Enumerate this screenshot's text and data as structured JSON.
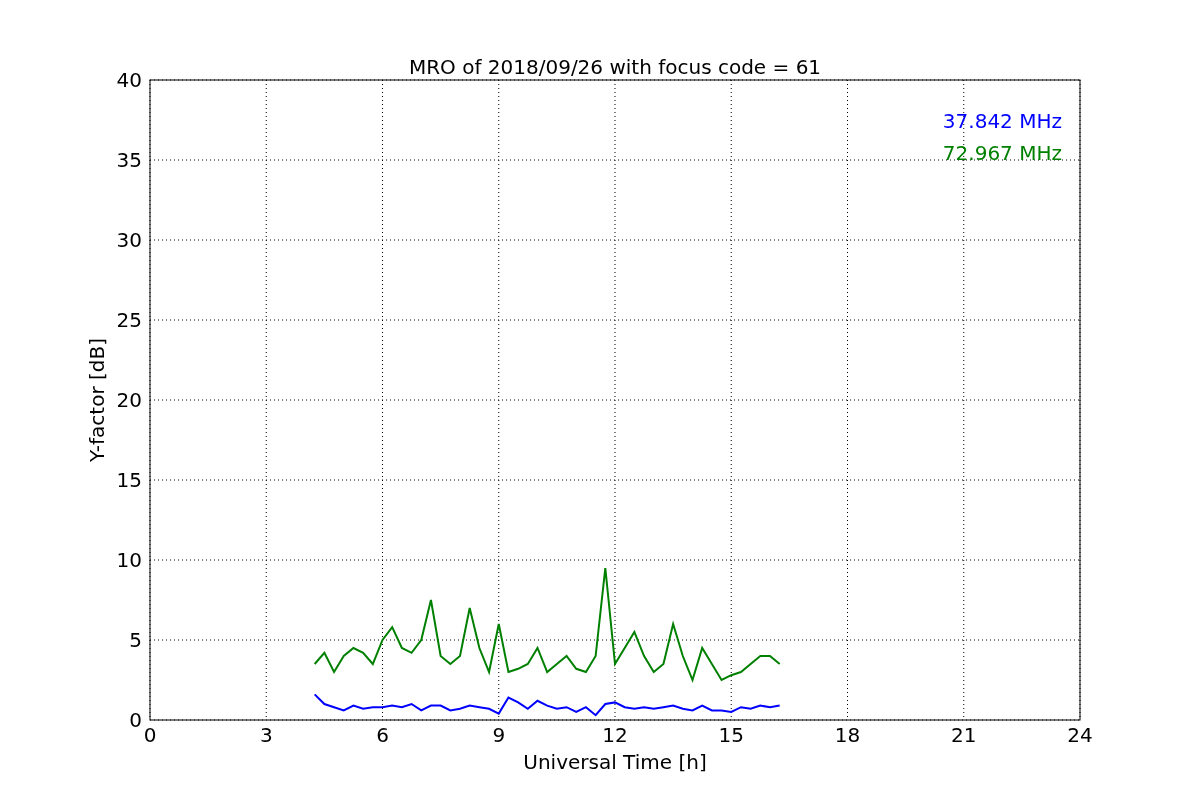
{
  "chart_data": {
    "type": "line",
    "title": "MRO of 2018/09/26 with focus code = 61",
    "xlabel": "Universal Time [h]",
    "ylabel": "Y-factor [dB]",
    "x": [
      4.25,
      4.5,
      4.75,
      5,
      5.25,
      5.5,
      5.75,
      6,
      6.25,
      6.5,
      6.75,
      7,
      7.25,
      7.5,
      7.75,
      8,
      8.25,
      8.5,
      8.75,
      9,
      9.25,
      9.5,
      9.75,
      10,
      10.25,
      10.5,
      10.75,
      11,
      11.25,
      11.5,
      11.75,
      12,
      12.25,
      12.5,
      12.75,
      13,
      13.25,
      13.5,
      13.75,
      14,
      14.25,
      14.5,
      14.75,
      15,
      15.25,
      15.5,
      15.75,
      16,
      16.25
    ],
    "series": [
      {
        "name": "37.842 MHz",
        "color": "#0000ff",
        "values": [
          1.6,
          1.0,
          0.8,
          0.6,
          0.9,
          0.7,
          0.8,
          0.8,
          0.9,
          0.8,
          1.0,
          0.6,
          0.9,
          0.9,
          0.6,
          0.7,
          0.9,
          0.8,
          0.7,
          0.4,
          1.4,
          1.1,
          0.7,
          1.2,
          0.9,
          0.7,
          0.8,
          0.5,
          0.8,
          0.3,
          1.0,
          1.1,
          0.8,
          0.7,
          0.8,
          0.7,
          0.8,
          0.9,
          0.7,
          0.6,
          0.9,
          0.6,
          0.6,
          0.5,
          0.8,
          0.7,
          0.9,
          0.8,
          0.9
        ]
      },
      {
        "name": "72.967 MHz",
        "color": "#008000",
        "values": [
          3.5,
          4.2,
          3.0,
          4.0,
          4.5,
          4.2,
          3.5,
          5.0,
          5.8,
          4.5,
          4.2,
          5.0,
          7.5,
          4.0,
          3.5,
          4.0,
          7.0,
          4.5,
          3.0,
          6.0,
          3.0,
          3.2,
          3.5,
          4.5,
          3.0,
          3.5,
          4.0,
          3.2,
          3.0,
          4.0,
          9.5,
          3.5,
          4.5,
          5.5,
          4.0,
          3.0,
          3.5,
          6.0,
          4.0,
          2.5,
          4.5,
          3.5,
          2.5,
          2.8,
          3.0,
          3.5,
          4.0,
          4.0,
          3.5
        ]
      }
    ],
    "grid": true,
    "xlim": [
      0,
      24
    ],
    "ylim": [
      0,
      40
    ],
    "xticks": [
      0,
      3,
      6,
      9,
      12,
      15,
      18,
      21,
      24
    ],
    "yticks": [
      0,
      5,
      10,
      15,
      20,
      25,
      30,
      35,
      40
    ]
  }
}
